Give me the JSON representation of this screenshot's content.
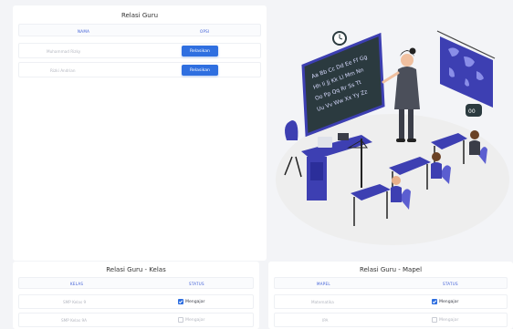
{
  "relasi_guru": {
    "title": "Relasi Guru",
    "columns": [
      "NAMA",
      "OPSI"
    ],
    "rows": [
      {
        "nama": "Muhammad Rizky",
        "button": "Relasikan"
      },
      {
        "nama": "Rizki Andrian",
        "button": "Relasikan"
      }
    ]
  },
  "relasi_kelas": {
    "title": "Relasi Guru - Kelas",
    "columns": [
      "KELAS",
      "STATUS"
    ],
    "rows": [
      {
        "name": "SMP Kelas 9",
        "status": "Mengajar",
        "checked": true
      },
      {
        "name": "SMP Kelas 9A",
        "status": "Mengajar",
        "checked": false
      }
    ]
  },
  "relasi_mapel": {
    "title": "Relasi Guru - Mapel",
    "columns": [
      "MAPEL",
      "STATUS"
    ],
    "rows": [
      {
        "name": "Matematika",
        "status": "Mengajar",
        "checked": true
      },
      {
        "name": "IPA",
        "status": "Mengajar",
        "checked": false
      }
    ]
  },
  "chalkboard_letters": "Aa Bb Cc Dd Ee Ff Gg Hh Ii Jj Kk Ll Mm Nn Oo Pp Qq Rr Ss Tt Uu Vv Ww Xx Yy Zz",
  "colors": {
    "accent": "#2f6fe0",
    "illustration_primary": "#3d3fb2",
    "board": "#2b3a3f"
  }
}
